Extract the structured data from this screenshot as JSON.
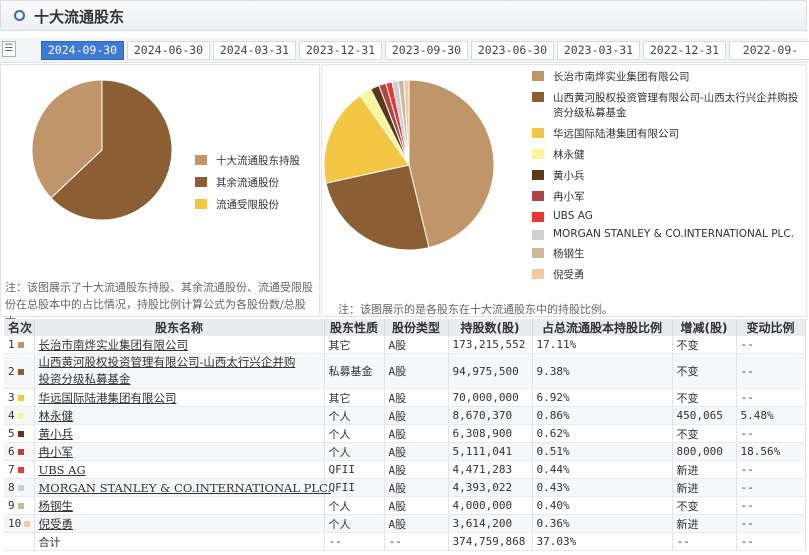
{
  "header": {
    "title": "十大流通股东"
  },
  "tabs": [
    "2024-09-30",
    "2024-06-30",
    "2024-03-31",
    "2023-12-31",
    "2023-09-30",
    "2023-06-30",
    "2023-03-31",
    "2022-12-31",
    "2022-09-"
  ],
  "active_tab": 0,
  "left_chart": {
    "note": "注：该图展示了十大流通股东持股、其余流通股份、流通受限股份在总股本中的占比情况，持股比例计算公式为各股份数/总股本。",
    "chart_data": {
      "type": "pie",
      "labels": [
        "十大流通股东持股",
        "其余流通股份",
        "流通受限股份"
      ],
      "values": [
        37.03,
        62.97,
        0
      ],
      "colors": [
        "#c0956a",
        "#8b5e34",
        "#f2c744"
      ]
    }
  },
  "right_chart": {
    "note": "注：该图展示的是各股东在十大流通股东中的持股比例。",
    "chart_data": {
      "type": "pie",
      "labels": [
        "长治市南烨实业集团有限公司",
        "山西黄河股权投资管理有限公司-山西太行兴企并购投资分级私募基金",
        "华远国际陆港集团有限公司",
        "林永健",
        "黄小兵",
        "冉小军",
        "UBS AG",
        "MORGAN STANLEY & CO.INTERNATIONAL PLC.",
        "杨钢生",
        "倪受勇"
      ],
      "values": [
        173215552,
        94975500,
        70000000,
        8670370,
        6308900,
        5111041,
        4471283,
        4393022,
        4000000,
        3614200
      ],
      "colors": [
        "#c0956a",
        "#8b5e34",
        "#f2c744",
        "#fbf59a",
        "#5a3a16",
        "#b04545",
        "#e53935",
        "#cfcfcf",
        "#c7b99a",
        "#f3c9a1"
      ]
    }
  },
  "table": {
    "headers": [
      "名次",
      "股东名称",
      "股东性质",
      "股份类型",
      "持股数(股)",
      "占总流通股本持股比例",
      "增减(股)",
      "变动比例"
    ],
    "rows": [
      {
        "rank": "1",
        "name": "长治市南烨实业集团有限公司",
        "name2": "",
        "nature": "其它",
        "type": "A股",
        "shares": "173,215,552",
        "ratio": "17.11%",
        "change": "不变",
        "change_pct": "--",
        "color": "#c0956a"
      },
      {
        "rank": "2",
        "name": "山西黄河股权投资管理有限公司-山西太行兴企并购",
        "name2": "投资分级私募基金",
        "nature": "私募基金",
        "type": "A股",
        "shares": "94,975,500",
        "ratio": "9.38%",
        "change": "不变",
        "change_pct": "--",
        "color": "#8b5e34"
      },
      {
        "rank": "3",
        "name": "华远国际陆港集团有限公司",
        "name2": "",
        "nature": "其它",
        "type": "A股",
        "shares": "70,000,000",
        "ratio": "6.92%",
        "change": "不变",
        "change_pct": "--",
        "color": "#f2c744"
      },
      {
        "rank": "4",
        "name": "林永健",
        "name2": "",
        "nature": "个人",
        "type": "A股",
        "shares": "8,670,370",
        "ratio": "0.86%",
        "change": "450,065",
        "change_pct": "5.48%",
        "color": "#fbf59a"
      },
      {
        "rank": "5",
        "name": "黄小兵",
        "name2": "",
        "nature": "个人",
        "type": "A股",
        "shares": "6,308,900",
        "ratio": "0.62%",
        "change": "不变",
        "change_pct": "--",
        "color": "#5a3a16"
      },
      {
        "rank": "6",
        "name": "冉小军",
        "name2": "",
        "nature": "个人",
        "type": "A股",
        "shares": "5,111,041",
        "ratio": "0.51%",
        "change": "800,000",
        "change_pct": "18.56%",
        "color": "#b04545"
      },
      {
        "rank": "7",
        "name": "UBS AG",
        "name2": "",
        "nature": "QFII",
        "type": "A股",
        "shares": "4,471,283",
        "ratio": "0.44%",
        "change": "新进",
        "change_pct": "--",
        "color": "#e53935"
      },
      {
        "rank": "8",
        "name": "MORGAN STANLEY & CO.INTERNATIONAL PLC.",
        "name2": "",
        "nature": "QFII",
        "type": "A股",
        "shares": "4,393,022",
        "ratio": "0.43%",
        "change": "新进",
        "change_pct": "--",
        "color": "#cfcfcf"
      },
      {
        "rank": "9",
        "name": "杨钢生",
        "name2": "",
        "nature": "个人",
        "type": "A股",
        "shares": "4,000,000",
        "ratio": "0.40%",
        "change": "不变",
        "change_pct": "--",
        "color": "#c7b99a"
      },
      {
        "rank": "10",
        "name": "倪受勇",
        "name2": "",
        "nature": "个人",
        "type": "A股",
        "shares": "3,614,200",
        "ratio": "0.36%",
        "change": "新进",
        "change_pct": "--",
        "color": "#f3c9a1"
      }
    ],
    "total": {
      "label": "合计",
      "nature": "--",
      "type": "--",
      "shares": "374,759,868",
      "ratio": "37.03%",
      "change": "--",
      "change_pct": "--"
    }
  }
}
